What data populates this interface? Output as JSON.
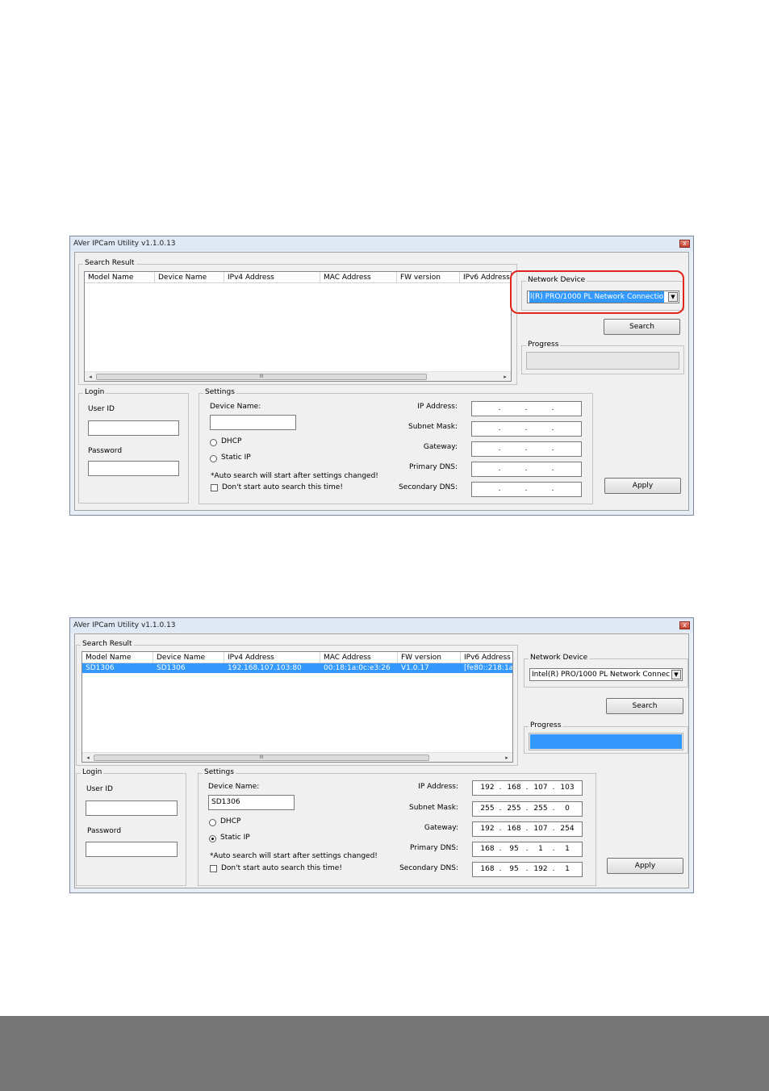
{
  "window1": {
    "title": "AVer IPCam Utility v1.1.0.13",
    "close_glyph": "x",
    "search_result": {
      "legend": "Search Result",
      "columns": [
        "Model Name",
        "Device Name",
        "IPv4 Address",
        "MAC Address",
        "FW version",
        "IPv6 Address"
      ],
      "rows": [],
      "scroll_left": "◂",
      "scroll_right": "▸",
      "scroll_grip": "III"
    },
    "network_device": {
      "legend": "Network Device",
      "selected": "l(R) PRO/1000 PL Network Connectio",
      "arrow": "▼"
    },
    "search_button": "Search",
    "progress": {
      "legend": "Progress",
      "value": 0
    },
    "login": {
      "legend": "Login",
      "user_id_label": "User ID",
      "user_id_value": "",
      "password_label": "Password",
      "password_value": ""
    },
    "settings": {
      "legend": "Settings",
      "device_name_label": "Device Name:",
      "device_name_value": "",
      "dhcp_label": "DHCP",
      "static_ip_label": "Static IP",
      "dhcp_selected": false,
      "static_selected": false,
      "note": "*Auto search will start after settings changed!",
      "checkbox_label": "Don't start auto search this time!",
      "checkbox_checked": false,
      "fields": [
        {
          "label": "IP Address:",
          "octets": [
            "",
            "",
            "",
            ""
          ]
        },
        {
          "label": "Subnet Mask:",
          "octets": [
            "",
            "",
            "",
            ""
          ]
        },
        {
          "label": "Gateway:",
          "octets": [
            "",
            "",
            "",
            ""
          ]
        },
        {
          "label": "Primary DNS:",
          "octets": [
            "",
            "",
            "",
            ""
          ]
        },
        {
          "label": "Secondary DNS:",
          "octets": [
            "",
            "",
            "",
            ""
          ]
        }
      ]
    },
    "apply_button": "Apply"
  },
  "window2": {
    "title": "AVer IPCam Utility v1.1.0.13",
    "close_glyph": "x",
    "search_result": {
      "legend": "Search Result",
      "columns": [
        "Model Name",
        "Device Name",
        "IPv4 Address",
        "MAC Address",
        "FW version",
        "IPv6 Address"
      ],
      "rows": [
        [
          "SD1306",
          "SD1306",
          "192.168.107.103:80",
          "00:18:1a:0c:e3:26",
          "V1.0.17",
          "[fe80::218:1a"
        ]
      ],
      "scroll_left": "◂",
      "scroll_right": "▸",
      "scroll_grip": "III"
    },
    "network_device": {
      "legend": "Network Device",
      "selected": "Intel(R) PRO/1000 PL Network Connec",
      "arrow": "▼"
    },
    "search_button": "Search",
    "progress": {
      "legend": "Progress",
      "value": 100
    },
    "login": {
      "legend": "Login",
      "user_id_label": "User ID",
      "user_id_value": "",
      "password_label": "Password",
      "password_value": ""
    },
    "settings": {
      "legend": "Settings",
      "device_name_label": "Device Name:",
      "device_name_value": "SD1306",
      "dhcp_label": "DHCP",
      "static_ip_label": "Static IP",
      "dhcp_selected": false,
      "static_selected": true,
      "note": "*Auto search will start after settings changed!",
      "checkbox_label": "Don't start auto search this time!",
      "checkbox_checked": false,
      "fields": [
        {
          "label": "IP Address:",
          "octets": [
            "192",
            "168",
            "107",
            "103"
          ]
        },
        {
          "label": "Subnet Mask:",
          "octets": [
            "255",
            "255",
            "255",
            "0"
          ]
        },
        {
          "label": "Gateway:",
          "octets": [
            "192",
            "168",
            "107",
            "254"
          ]
        },
        {
          "label": "Primary DNS:",
          "octets": [
            "168",
            "95",
            "1",
            "1"
          ]
        },
        {
          "label": "Secondary DNS:",
          "octets": [
            "168",
            "95",
            "192",
            "1"
          ]
        }
      ]
    },
    "apply_button": "Apply"
  },
  "colors": {
    "highlight": "#3399ff",
    "callout": "#e0261b",
    "footer": "#767676"
  }
}
